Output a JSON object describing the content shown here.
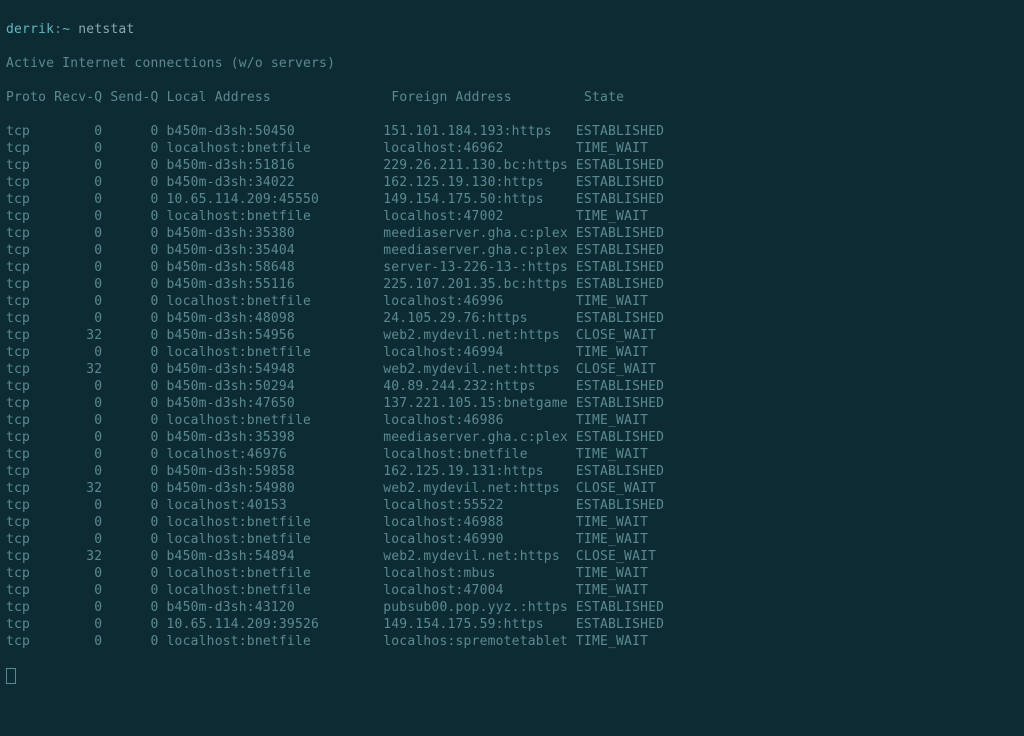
{
  "prompt": {
    "user": "derrik",
    "sep": ":",
    "path": "~",
    "command": "netstat"
  },
  "title_line": "Active Internet connections (w/o servers)",
  "columns": {
    "proto": "Proto",
    "recvq": "Recv-Q",
    "sendq": "Send-Q",
    "local": "Local Address",
    "foreign": "Foreign Address",
    "state": "State"
  },
  "rows": [
    {
      "proto": "tcp",
      "recvq": "0",
      "sendq": "0",
      "local": "b450m-d3sh:50450",
      "foreign": "151.101.184.193:https",
      "state": "ESTABLISHED"
    },
    {
      "proto": "tcp",
      "recvq": "0",
      "sendq": "0",
      "local": "localhost:bnetfile",
      "foreign": "localhost:46962",
      "state": "TIME_WAIT"
    },
    {
      "proto": "tcp",
      "recvq": "0",
      "sendq": "0",
      "local": "b450m-d3sh:51816",
      "foreign": "229.26.211.130.bc:https",
      "state": "ESTABLISHED"
    },
    {
      "proto": "tcp",
      "recvq": "0",
      "sendq": "0",
      "local": "b450m-d3sh:34022",
      "foreign": "162.125.19.130:https",
      "state": "ESTABLISHED"
    },
    {
      "proto": "tcp",
      "recvq": "0",
      "sendq": "0",
      "local": "10.65.114.209:45550",
      "foreign": "149.154.175.50:https",
      "state": "ESTABLISHED"
    },
    {
      "proto": "tcp",
      "recvq": "0",
      "sendq": "0",
      "local": "localhost:bnetfile",
      "foreign": "localhost:47002",
      "state": "TIME_WAIT"
    },
    {
      "proto": "tcp",
      "recvq": "0",
      "sendq": "0",
      "local": "b450m-d3sh:35380",
      "foreign": "meediaserver.gha.c:plex",
      "state": "ESTABLISHED"
    },
    {
      "proto": "tcp",
      "recvq": "0",
      "sendq": "0",
      "local": "b450m-d3sh:35404",
      "foreign": "meediaserver.gha.c:plex",
      "state": "ESTABLISHED"
    },
    {
      "proto": "tcp",
      "recvq": "0",
      "sendq": "0",
      "local": "b450m-d3sh:58648",
      "foreign": "server-13-226-13-:https",
      "state": "ESTABLISHED"
    },
    {
      "proto": "tcp",
      "recvq": "0",
      "sendq": "0",
      "local": "b450m-d3sh:55116",
      "foreign": "225.107.201.35.bc:https",
      "state": "ESTABLISHED"
    },
    {
      "proto": "tcp",
      "recvq": "0",
      "sendq": "0",
      "local": "localhost:bnetfile",
      "foreign": "localhost:46996",
      "state": "TIME_WAIT"
    },
    {
      "proto": "tcp",
      "recvq": "0",
      "sendq": "0",
      "local": "b450m-d3sh:48098",
      "foreign": "24.105.29.76:https",
      "state": "ESTABLISHED"
    },
    {
      "proto": "tcp",
      "recvq": "32",
      "sendq": "0",
      "local": "b450m-d3sh:54956",
      "foreign": "web2.mydevil.net:https",
      "state": "CLOSE_WAIT"
    },
    {
      "proto": "tcp",
      "recvq": "0",
      "sendq": "0",
      "local": "localhost:bnetfile",
      "foreign": "localhost:46994",
      "state": "TIME_WAIT"
    },
    {
      "proto": "tcp",
      "recvq": "32",
      "sendq": "0",
      "local": "b450m-d3sh:54948",
      "foreign": "web2.mydevil.net:https",
      "state": "CLOSE_WAIT"
    },
    {
      "proto": "tcp",
      "recvq": "0",
      "sendq": "0",
      "local": "b450m-d3sh:50294",
      "foreign": "40.89.244.232:https",
      "state": "ESTABLISHED"
    },
    {
      "proto": "tcp",
      "recvq": "0",
      "sendq": "0",
      "local": "b450m-d3sh:47650",
      "foreign": "137.221.105.15:bnetgame",
      "state": "ESTABLISHED"
    },
    {
      "proto": "tcp",
      "recvq": "0",
      "sendq": "0",
      "local": "localhost:bnetfile",
      "foreign": "localhost:46986",
      "state": "TIME_WAIT"
    },
    {
      "proto": "tcp",
      "recvq": "0",
      "sendq": "0",
      "local": "b450m-d3sh:35398",
      "foreign": "meediaserver.gha.c:plex",
      "state": "ESTABLISHED"
    },
    {
      "proto": "tcp",
      "recvq": "0",
      "sendq": "0",
      "local": "localhost:46976",
      "foreign": "localhost:bnetfile",
      "state": "TIME_WAIT"
    },
    {
      "proto": "tcp",
      "recvq": "0",
      "sendq": "0",
      "local": "b450m-d3sh:59858",
      "foreign": "162.125.19.131:https",
      "state": "ESTABLISHED"
    },
    {
      "proto": "tcp",
      "recvq": "32",
      "sendq": "0",
      "local": "b450m-d3sh:54980",
      "foreign": "web2.mydevil.net:https",
      "state": "CLOSE_WAIT"
    },
    {
      "proto": "tcp",
      "recvq": "0",
      "sendq": "0",
      "local": "localhost:40153",
      "foreign": "localhost:55522",
      "state": "ESTABLISHED"
    },
    {
      "proto": "tcp",
      "recvq": "0",
      "sendq": "0",
      "local": "localhost:bnetfile",
      "foreign": "localhost:46988",
      "state": "TIME_WAIT"
    },
    {
      "proto": "tcp",
      "recvq": "0",
      "sendq": "0",
      "local": "localhost:bnetfile",
      "foreign": "localhost:46990",
      "state": "TIME_WAIT"
    },
    {
      "proto": "tcp",
      "recvq": "32",
      "sendq": "0",
      "local": "b450m-d3sh:54894",
      "foreign": "web2.mydevil.net:https",
      "state": "CLOSE_WAIT"
    },
    {
      "proto": "tcp",
      "recvq": "0",
      "sendq": "0",
      "local": "localhost:bnetfile",
      "foreign": "localhost:mbus",
      "state": "TIME_WAIT"
    },
    {
      "proto": "tcp",
      "recvq": "0",
      "sendq": "0",
      "local": "localhost:bnetfile",
      "foreign": "localhost:47004",
      "state": "TIME_WAIT"
    },
    {
      "proto": "tcp",
      "recvq": "0",
      "sendq": "0",
      "local": "b450m-d3sh:43120",
      "foreign": "pubsub00.pop.yyz.:https",
      "state": "ESTABLISHED"
    },
    {
      "proto": "tcp",
      "recvq": "0",
      "sendq": "0",
      "local": "10.65.114.209:39526",
      "foreign": "149.154.175.59:https",
      "state": "ESTABLISHED"
    },
    {
      "proto": "tcp",
      "recvq": "0",
      "sendq": "0",
      "local": "localhost:bnetfile",
      "foreign": "localhos:spremotetablet",
      "state": "TIME_WAIT"
    }
  ]
}
